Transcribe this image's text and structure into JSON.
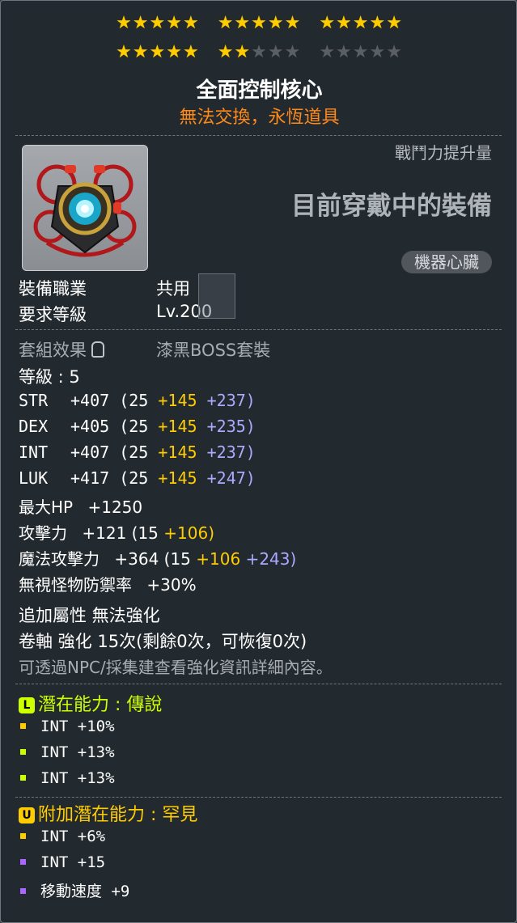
{
  "star_force": {
    "row1": [
      "★★★★★",
      "★★★★★",
      "★★★★★"
    ],
    "row2_on": [
      "★★★★★",
      "★★"
    ],
    "row2_off": [
      "★★★",
      "★★★★★"
    ],
    "filled": 22,
    "total": 30
  },
  "item": {
    "name": "全面控制核心",
    "trade_status": "無法交換，永恆道具",
    "cp_label": "戰鬥力提升量",
    "equipped_label": "目前穿戴中的裝備",
    "category": "機器心臟"
  },
  "requirements": {
    "job_label": "裝備職業",
    "job_value": "共用",
    "level_label": "要求等級",
    "level_value": "Lv.200"
  },
  "set": {
    "label": "套組效果",
    "value": "漆黑BOSS套裝"
  },
  "grade": "等級 : 5",
  "stats": [
    {
      "key": "STR",
      "total": "+407",
      "base": "(25",
      "bonus": "+145",
      "star": "+237)"
    },
    {
      "key": "DEX",
      "total": "+405",
      "base": "(25",
      "bonus": "+145",
      "star": "+235)"
    },
    {
      "key": "INT",
      "total": "+407",
      "base": "(25",
      "bonus": "+145",
      "star": "+237)"
    },
    {
      "key": "LUK",
      "total": "+417",
      "base": "(25",
      "bonus": "+145",
      "star": "+247)"
    }
  ],
  "max_hp": {
    "label": "最大HP",
    "value": "+1250"
  },
  "attack": {
    "label": "攻擊力",
    "total": "+121",
    "base": "(15",
    "bonus": "+106)"
  },
  "magic_attack": {
    "label": "魔法攻擊力",
    "total": "+364",
    "base": "(15",
    "bonus": "+106",
    "star": "+243)"
  },
  "ignore_def": {
    "label": "無視怪物防禦率",
    "value": "+30%"
  },
  "extra": {
    "bonus_stat": "追加屬性 無法強化",
    "scroll": "卷軸 強化 15次(剩餘0次，可恢復0次)",
    "hint": "可透過NPC/採集建查看強化資訊詳細內容。"
  },
  "potential": {
    "icon": "L",
    "title": "潛在能力 : 傳說",
    "color": "#ccff00",
    "lines": [
      "INT +10%",
      "INT +13%",
      "INT +13%"
    ],
    "bullet_colors": [
      "#ffcc00",
      "#ccff00",
      "#ccff00"
    ]
  },
  "additional_potential": {
    "icon": "U",
    "title": "附加潛在能力 : 罕見",
    "color": "#ffcc00",
    "lines": [
      "INT +6%",
      "INT +15",
      "移動速度 +9"
    ],
    "bullet_colors": [
      "#ffcc00",
      "#aa66ff",
      "#aa66ff"
    ]
  }
}
